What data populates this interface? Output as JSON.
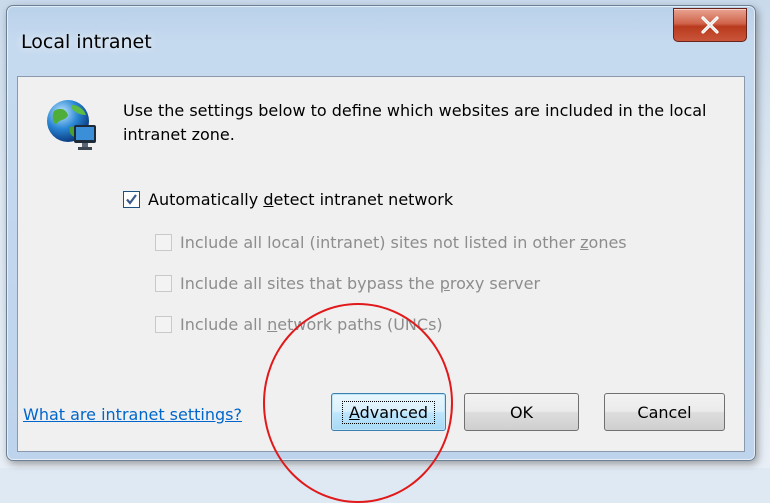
{
  "window": {
    "title": "Local intranet",
    "close_symbol": "X"
  },
  "description": "Use the settings below to define which websites are included in the local intranet zone.",
  "options": [
    {
      "before": "Automatically ",
      "accel": "d",
      "after": "etect intranet network",
      "checked": true,
      "enabled": true
    },
    {
      "before": "Include all local (intranet) sites not listed in other ",
      "accel": "z",
      "after": "ones",
      "checked": false,
      "enabled": false
    },
    {
      "before": "Include all sites that bypass the ",
      "accel": "p",
      "after": "roxy server",
      "checked": false,
      "enabled": false
    },
    {
      "before": "Include all ",
      "accel": "n",
      "after": "etwork paths (UNCs)",
      "checked": false,
      "enabled": false
    }
  ],
  "footer": {
    "help_link": "What are intranet settings?",
    "advanced": {
      "accel": "A",
      "rest": "dvanced"
    },
    "ok_label": "OK",
    "cancel_label": "Cancel"
  },
  "colors": {
    "link": "#0066cc",
    "annotation_circle": "#e0191b",
    "close_button": "#c9553a"
  },
  "icons": [
    "intranet-globe-icon",
    "close-icon",
    "checkmark-icon"
  ]
}
